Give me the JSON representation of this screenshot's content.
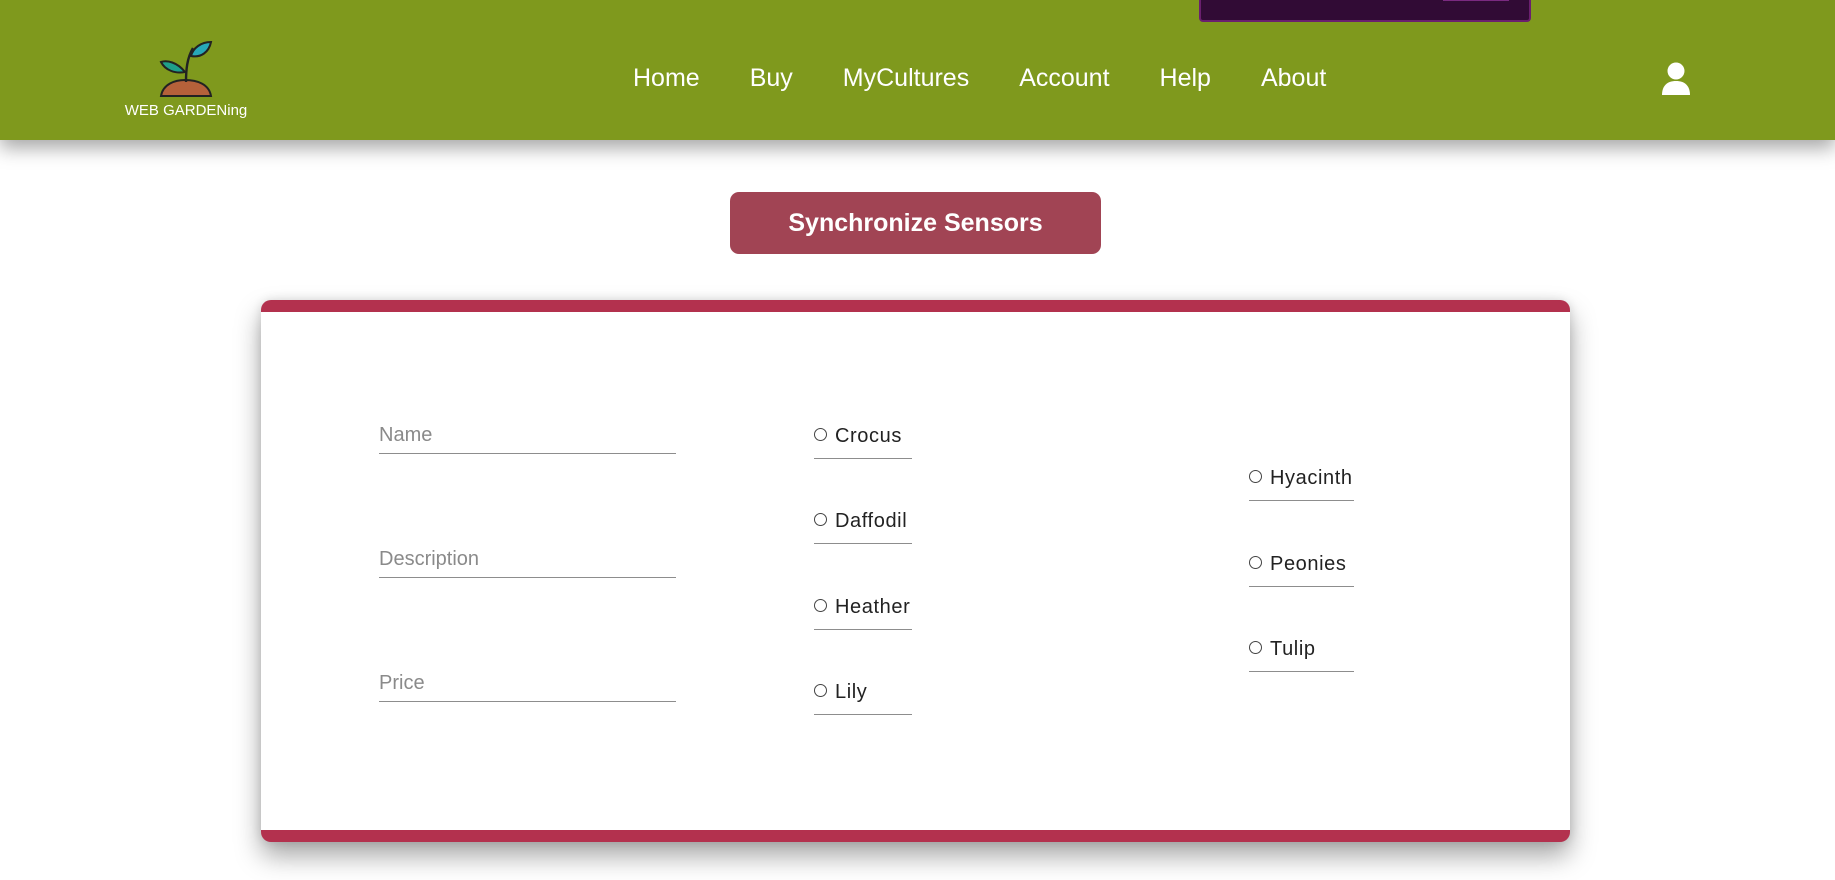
{
  "brand": {
    "name": "WEB GARDENing"
  },
  "nav": [
    {
      "label": "Home"
    },
    {
      "label": "Buy"
    },
    {
      "label": "MyCultures"
    },
    {
      "label": "Account"
    },
    {
      "label": "Help"
    },
    {
      "label": "About"
    }
  ],
  "icons": {
    "logo": "sprout-icon",
    "user": "user-icon"
  },
  "colors": {
    "header": "#7f991d",
    "button": "#a14454",
    "card_border": "#b3314e"
  },
  "sync_button": {
    "label": "Synchronize Sensors"
  },
  "form": {
    "name_placeholder": "Name",
    "description_placeholder": "Description",
    "price_placeholder": "Price"
  },
  "flowers_col1": [
    "Crocus",
    "Daffodil",
    "Heather",
    "Lily"
  ],
  "flowers_col2": [
    "Hyacinth",
    "Peonies",
    "Tulip"
  ]
}
